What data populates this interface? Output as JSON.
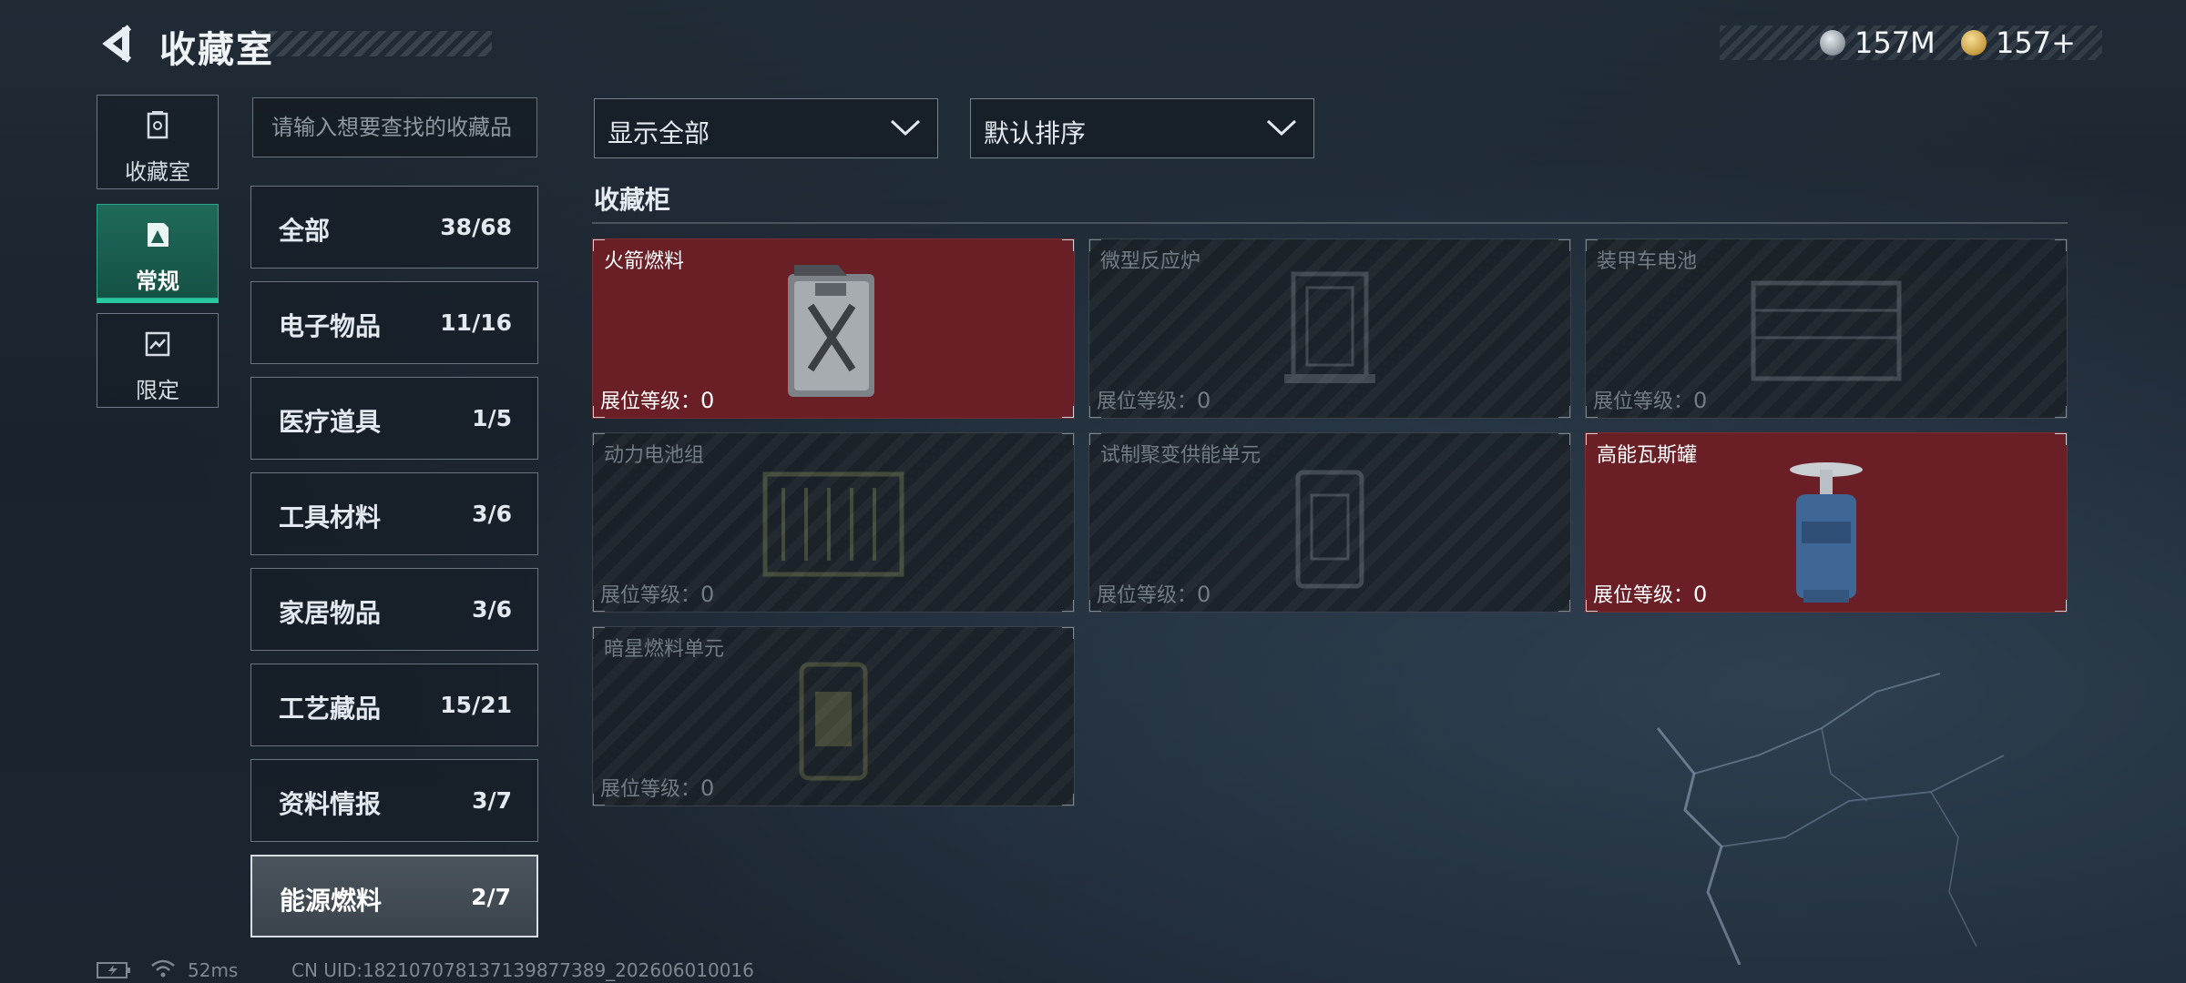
{
  "header": {
    "title": "收藏室"
  },
  "currency": [
    {
      "value": "157M",
      "icon": "silver-coin-icon",
      "color": "#bfc7cf"
    },
    {
      "value": "157+",
      "icon": "gold-coin-icon",
      "color": "#d7b05a"
    }
  ],
  "leftnav": [
    {
      "label": "收藏室",
      "icon": "vault-icon",
      "active": false
    },
    {
      "label": "常规",
      "icon": "regular-card-icon",
      "active": true
    },
    {
      "label": "限定",
      "icon": "limited-card-icon",
      "active": false
    }
  ],
  "search": {
    "placeholder": "请输入想要查找的收藏品"
  },
  "categories": [
    {
      "name": "全部",
      "count": "38/68"
    },
    {
      "name": "电子物品",
      "count": "11/16"
    },
    {
      "name": "医疗道具",
      "count": "1/5"
    },
    {
      "name": "工具材料",
      "count": "3/6"
    },
    {
      "name": "家居物品",
      "count": "3/6"
    },
    {
      "name": "工艺藏品",
      "count": "15/21"
    },
    {
      "name": "资料情报",
      "count": "3/7"
    },
    {
      "name": "能源燃料",
      "count": "2/7",
      "active": true
    }
  ],
  "filters": {
    "show": {
      "value": "显示全部"
    },
    "sort": {
      "value": "默认排序"
    }
  },
  "cabinet": {
    "title": "收藏柜",
    "level_label": "展位等级：",
    "items": [
      {
        "name": "火箭燃料",
        "level": "0",
        "unlocked": true,
        "icon": "fuel-canister-icon"
      },
      {
        "name": "微型反应炉",
        "level": "0",
        "unlocked": false,
        "icon": "mini-reactor-icon"
      },
      {
        "name": "装甲车电池",
        "level": "0",
        "unlocked": false,
        "icon": "vehicle-battery-icon"
      },
      {
        "name": "动力电池组",
        "level": "0",
        "unlocked": false,
        "icon": "battery-pack-icon"
      },
      {
        "name": "试制聚变供能单元",
        "level": "0",
        "unlocked": false,
        "icon": "fusion-unit-icon"
      },
      {
        "name": "高能瓦斯罐",
        "level": "0",
        "unlocked": true,
        "icon": "gas-cylinder-icon"
      },
      {
        "name": "暗星燃料单元",
        "level": "0",
        "unlocked": false,
        "icon": "darkstar-fuel-cell-icon"
      }
    ]
  },
  "status": {
    "ping": "52ms",
    "uid": "CN UID:18210707813713987​7389_202606010016"
  }
}
